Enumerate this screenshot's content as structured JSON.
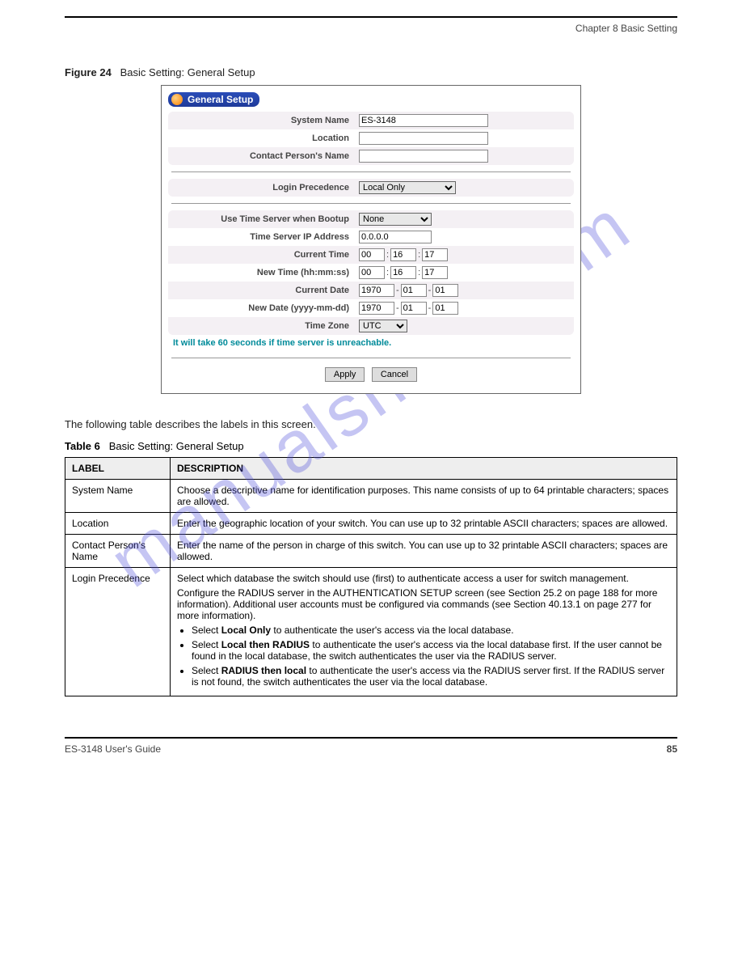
{
  "header": {
    "chapter": "Chapter 8 Basic Setting"
  },
  "figure": {
    "number": "Figure 24",
    "title": "Basic Setting: General Setup"
  },
  "panel": {
    "title": "General Setup",
    "labels": {
      "system_name": "System Name",
      "location": "Location",
      "contact": "Contact Person's Name",
      "login_precedence": "Login Precedence",
      "use_time_server": "Use Time Server when Bootup",
      "time_server_ip": "Time Server IP Address",
      "current_time": "Current Time",
      "new_time": "New Time (hh:mm:ss)",
      "current_date": "Current Date",
      "new_date": "New Date (yyyy-mm-dd)",
      "time_zone": "Time Zone"
    },
    "values": {
      "system_name": "ES-3148",
      "location": "",
      "contact": "",
      "login_precedence": "Local Only",
      "use_time_server": "None",
      "time_server_ip": "0.0.0.0",
      "current_time_h": "00",
      "current_time_m": "16",
      "current_time_s": "17",
      "new_time_h": "00",
      "new_time_m": "16",
      "new_time_s": "17",
      "current_date_y": "1970",
      "current_date_m": "01",
      "current_date_d": "01",
      "new_date_y": "1970",
      "new_date_m": "01",
      "new_date_d": "01",
      "time_zone": "UTC"
    },
    "note": "It will take 60 seconds if time server is unreachable.",
    "buttons": {
      "apply": "Apply",
      "cancel": "Cancel"
    }
  },
  "body_text": "The following table describes the labels in this screen.",
  "table": {
    "caption_number": "Table 6",
    "caption_title": "Basic Setting: General Setup",
    "headers": {
      "label": "LABEL",
      "description": "DESCRIPTION"
    },
    "rows": [
      {
        "label": "System Name",
        "desc": "Choose a descriptive name for identification purposes. This name consists of up to 64 printable characters; spaces are allowed."
      },
      {
        "label": "Location",
        "desc": "Enter the geographic location of your switch. You can use up to 32 printable ASCII characters; spaces are allowed."
      },
      {
        "label": "Contact Person's Name",
        "desc": "Enter the name of the person in charge of this switch. You can use up to 32 printable ASCII characters; spaces are allowed."
      },
      {
        "label": "Login Precedence",
        "desc_intro": "Select which database the switch should use (first) to authenticate access a user for switch management.",
        "desc_sub": "Configure the RADIUS server in the AUTHENTICATION SETUP screen (see Section 25.2 on page 188 for more information). Additional user accounts must be configured via commands (see Section 40.13.1 on page 277 for more information).",
        "opt1_prefix": "Select",
        "opt1_bold": "Local Only",
        "opt1_rest": "to authenticate the user's access via the local database.",
        "opt2_prefix": "Select",
        "opt2_bold": "Local then RADIUS",
        "opt2_rest": "to authenticate the user's access via the local database first. If the user cannot be found in the local database, the switch authenticates the user via the RADIUS server.",
        "opt3_prefix": "Select",
        "opt3_bold": "RADIUS then local",
        "opt3_rest": "to authenticate the user's access via the RADIUS server first. If the RADIUS server is not found, the switch authenticates the user via the local database."
      }
    ]
  },
  "footer": {
    "left": "ES-3148 User's Guide",
    "right": "85"
  },
  "watermark": "manualshive.com"
}
